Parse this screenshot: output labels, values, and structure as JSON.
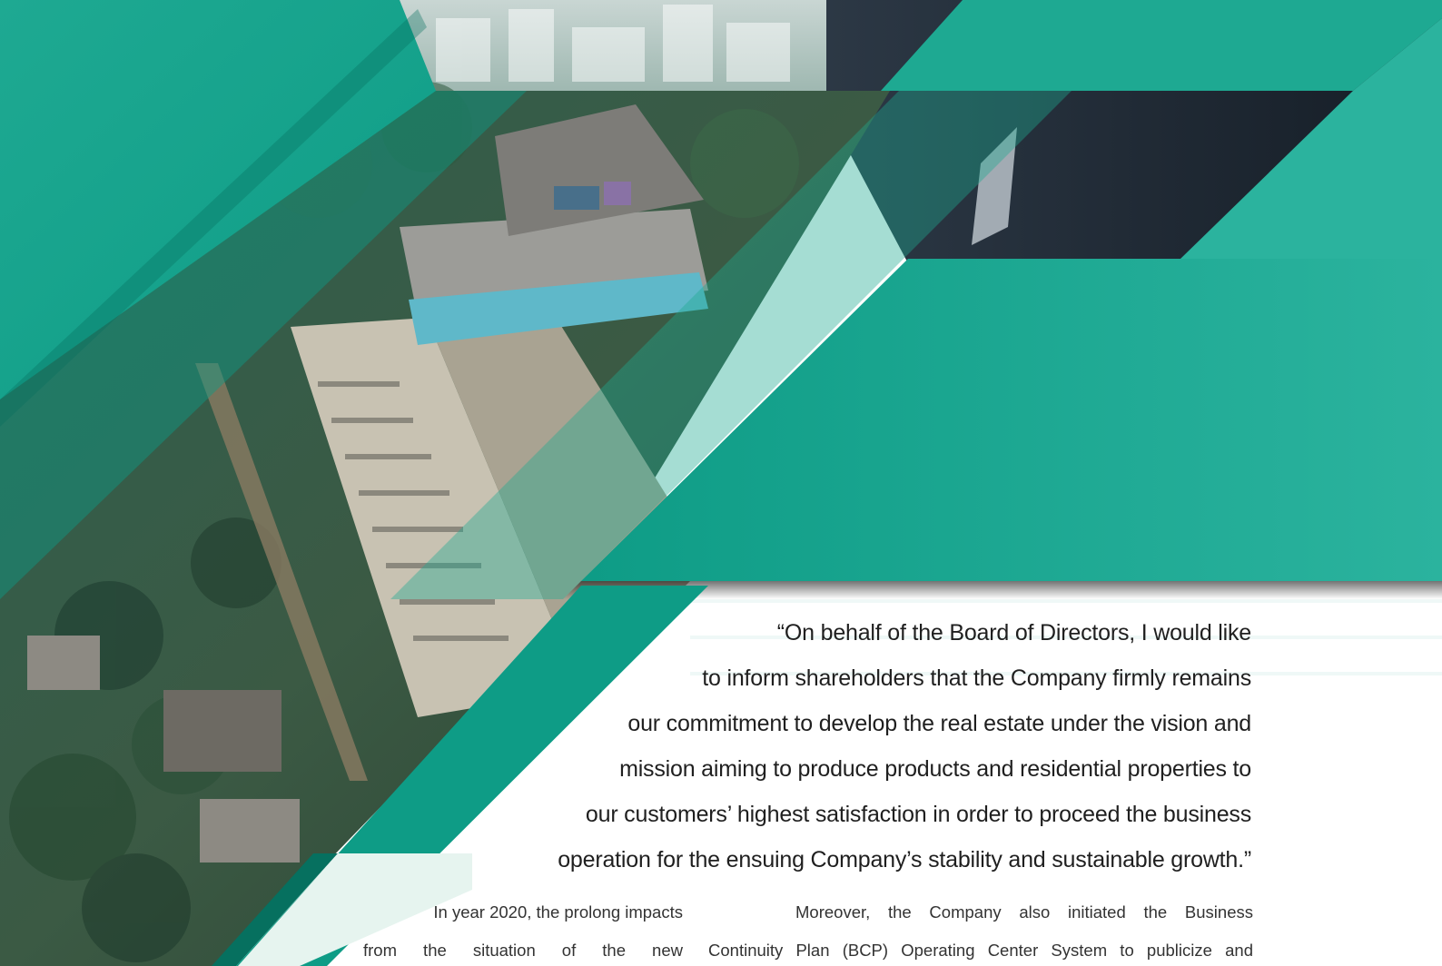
{
  "colors": {
    "teal_primary": "#0E9C86",
    "teal_light": "#2BB39E",
    "teal_dark": "#06705F",
    "mint_pale": "#E6F4EF",
    "suit_dark": "#1F2A36",
    "foliage": "#23433A",
    "building": "#B9B4A6"
  },
  "quote": {
    "lines": [
      "“On behalf of the Board of Directors, I would like",
      "to inform shareholders that the Company firmly remains",
      "our commitment to develop the real estate under the vision and",
      "mission aiming to produce products and residential properties to",
      "our customers’ highest satisfaction in order to proceed the business",
      "operation for the ensuing Company’s stability and sustainable growth.”"
    ]
  },
  "body": {
    "left_column": {
      "line1": "In year 2020, the prolong impacts",
      "line2": "from the situation of the new"
    },
    "right_column": {
      "line1": "Moreover, the Company also initiated the Business",
      "line2": "Continuity Plan (BCP) Operating Center System to publicize and"
    }
  }
}
